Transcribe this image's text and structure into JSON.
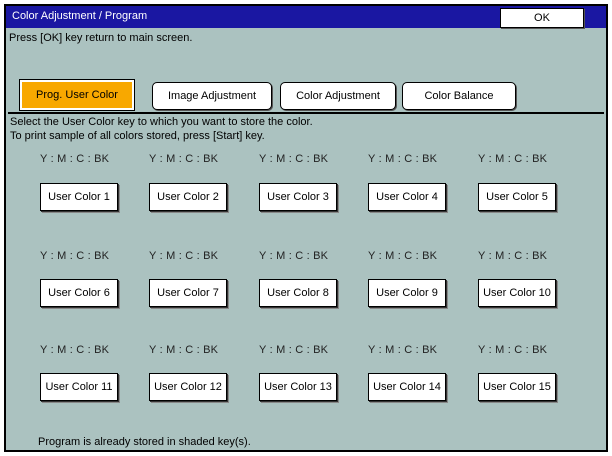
{
  "window": {
    "title": "Color Adjustment / Program",
    "ok_label": "OK",
    "message": "Press [OK] key return to main screen."
  },
  "tabs": [
    {
      "label": "Prog. User Color",
      "active": true
    },
    {
      "label": "Image Adjustment",
      "active": false
    },
    {
      "label": "Color Adjustment",
      "active": false
    },
    {
      "label": "Color Balance",
      "active": false
    }
  ],
  "instructions": {
    "line1": "Select the User Color key to which you want to store the color.",
    "line2": "To print sample of all colors stored,  press [Start] key."
  },
  "color_label": "Y : M : C : BK",
  "user_colors": [
    "User Color 1",
    "User Color 2",
    "User Color 3",
    "User Color 4",
    "User Color 5",
    "User Color 6",
    "User Color 7",
    "User Color 8",
    "User Color 9",
    "User Color 10",
    "User Color 11",
    "User Color 12",
    "User Color 13",
    "User Color 14",
    "User Color 15"
  ],
  "footer": "Program is already stored in shaded key(s).",
  "colors": {
    "title_bar": "#1a17a2",
    "panel": "#abc2c0",
    "active_tab": "#f8a800"
  }
}
